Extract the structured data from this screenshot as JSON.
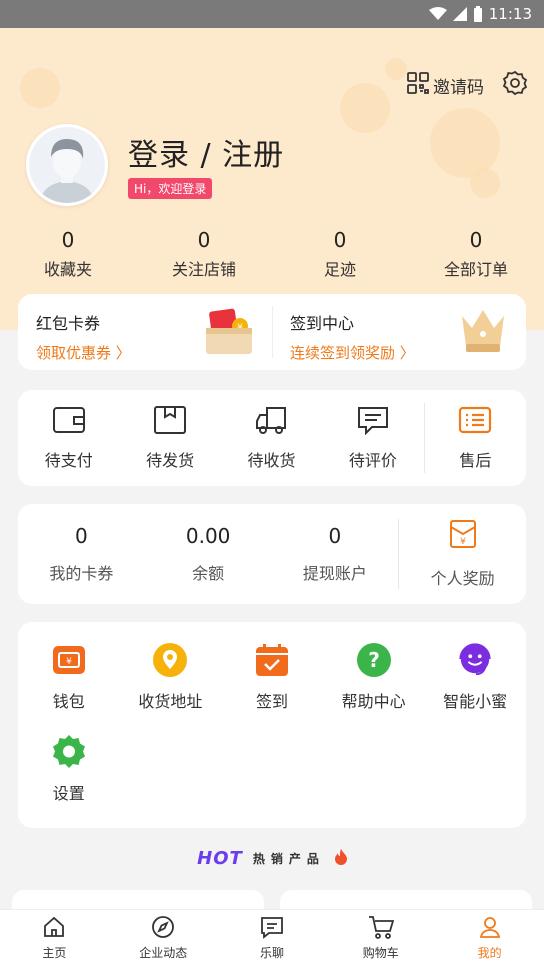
{
  "status_bar": {
    "time": "11:13"
  },
  "header": {
    "invite_label": "邀请码",
    "login_title": "登录 / 注册",
    "welcome_badge": "Hi，欢迎登录"
  },
  "stats": [
    {
      "value": "0",
      "label": "收藏夹"
    },
    {
      "value": "0",
      "label": "关注店铺"
    },
    {
      "value": "0",
      "label": "足迹"
    },
    {
      "value": "0",
      "label": "全部订单"
    }
  ],
  "promo": {
    "coupons": {
      "title": "红包卡券",
      "subtitle": "领取优惠券 〉"
    },
    "checkin": {
      "title": "签到中心",
      "subtitle": "连续签到领奖励 〉"
    }
  },
  "orders": [
    {
      "label": "待支付",
      "icon": "wallet-icon"
    },
    {
      "label": "待发货",
      "icon": "box-icon"
    },
    {
      "label": "待收货",
      "icon": "truck-icon"
    },
    {
      "label": "待评价",
      "icon": "comment-icon"
    },
    {
      "label": "售后",
      "icon": "list-icon"
    }
  ],
  "wallet": [
    {
      "value": "0",
      "label": "我的卡券"
    },
    {
      "value": "0.00",
      "label": "余额"
    },
    {
      "value": "0",
      "label": "提现账户"
    },
    {
      "label": "个人奖励",
      "icon": "red-envelope-icon"
    }
  ],
  "tools": [
    {
      "label": "钱包",
      "icon": "wallet-card-icon",
      "color": "#f26b1d"
    },
    {
      "label": "收货地址",
      "icon": "location-pin-icon",
      "color": "#f6b20a"
    },
    {
      "label": "签到",
      "icon": "calendar-check-icon",
      "color": "#f26b1d"
    },
    {
      "label": "帮助中心",
      "icon": "question-icon",
      "color": "#3bb54a"
    },
    {
      "label": "智能小蜜",
      "icon": "robot-face-icon",
      "color": "#7b2ee0"
    },
    {
      "label": "设置",
      "icon": "gear-icon",
      "color": "#3bb54a"
    }
  ],
  "hot": {
    "word": "HOT",
    "text": "热销产品"
  },
  "tabbar": [
    {
      "label": "主页",
      "icon": "home-icon",
      "active": false
    },
    {
      "label": "企业动态",
      "icon": "compass-icon",
      "active": false
    },
    {
      "label": "乐聊",
      "icon": "chat-icon",
      "active": false
    },
    {
      "label": "购物车",
      "icon": "cart-icon",
      "active": false
    },
    {
      "label": "我的",
      "icon": "user-icon",
      "active": true
    }
  ],
  "colors": {
    "accent": "#f07a1a",
    "header_bg": "#fde9cc",
    "badge": "#f2486c"
  }
}
